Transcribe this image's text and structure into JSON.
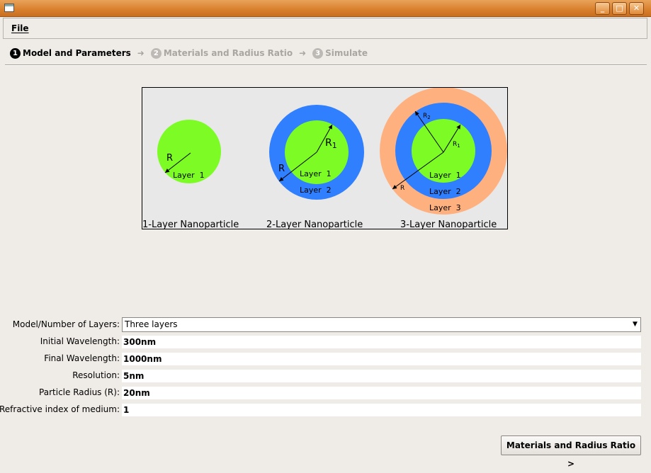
{
  "window": {
    "minimize_glyph": "_",
    "maximize_glyph": "□",
    "close_glyph": "✕"
  },
  "menu": {
    "file_label": "File"
  },
  "wizard_steps": [
    {
      "number": "1",
      "label": "Model and Parameters",
      "active": true
    },
    {
      "number": "2",
      "label": "Materials and Radius Ratio",
      "active": false
    },
    {
      "number": "3",
      "label": "Simulate",
      "active": false
    }
  ],
  "diagram": {
    "colors": {
      "layer1": "#7cfc24",
      "layer2": "#2f7fff",
      "layer3": "#ffb07f",
      "background": "#e8e8e8"
    },
    "particles": [
      {
        "caption": "1-Layer Nanoparticle",
        "labels": {
          "r": "R",
          "layer1": "Layer  1"
        }
      },
      {
        "caption": "2-Layer Nanoparticle",
        "labels": {
          "r": "R",
          "r1": "R",
          "r1_sub": "1",
          "layer1": "Layer  1",
          "layer2": "Layer  2"
        }
      },
      {
        "caption": "3-Layer Nanoparticle",
        "labels": {
          "r": "R",
          "r1": "R",
          "r1_sub": "1",
          "r2": "R",
          "r2_sub": "2",
          "layer1": "Layer  1",
          "layer2": "Layer  2",
          "layer3": "Layer  3"
        }
      }
    ]
  },
  "form": {
    "model_label": "Model/Number of Layers:",
    "model_value": "Three layers",
    "fields": [
      {
        "label": "Initial Wavelength:",
        "value": "300nm"
      },
      {
        "label": "Final Wavelength:",
        "value": "1000nm"
      },
      {
        "label": "Resolution:",
        "value": "5nm"
      },
      {
        "label": "Particle Radius (R):",
        "value": "20nm"
      },
      {
        "label": "Refractive index of medium:",
        "value": "1"
      }
    ]
  },
  "next_button_label": "Materials and Radius Ratio >"
}
